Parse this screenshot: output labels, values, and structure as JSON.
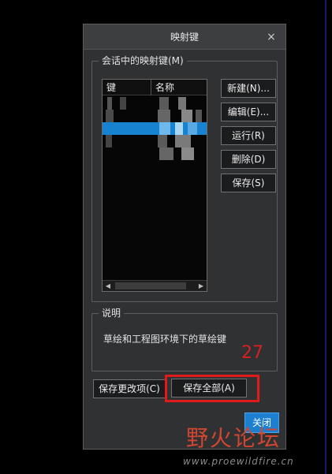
{
  "dialog": {
    "title": "映射键",
    "close_symbol": "×"
  },
  "mapkeys_group": {
    "legend": "会话中的映射键(M)",
    "columns": [
      "键",
      "名称"
    ],
    "buttons": {
      "new": "新建(N)...",
      "edit": "编辑(E)...",
      "run": "运行(R)",
      "delete": "删除(D)",
      "save": "保存(S)"
    },
    "scroll_left_symbol": "◀",
    "scroll_right_symbol": "▶"
  },
  "description_group": {
    "legend": "说明",
    "text": "草绘和工程图环境下的草绘键"
  },
  "bottom_buttons": {
    "save_changed": "保存更改项(C)",
    "save_all": "保存全部(A)",
    "close": "关闭"
  },
  "annotation": {
    "step_number": "27",
    "highlight_color": "#e11b1b"
  },
  "watermark": {
    "text": "野火论坛",
    "url": "www.proewildfire.cn"
  },
  "colors": {
    "selection": "#1782cf",
    "close_button": "#1c7fd0"
  }
}
